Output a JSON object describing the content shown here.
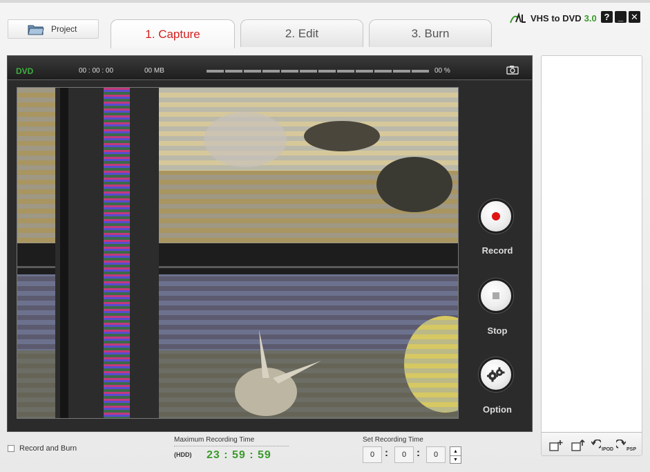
{
  "project_button": {
    "label": "Project",
    "icon": "folder-icon"
  },
  "tabs": [
    {
      "label": "1. Capture",
      "active": true
    },
    {
      "label": "2. Edit",
      "active": false
    },
    {
      "label": "3. Burn",
      "active": false
    }
  ],
  "brand": {
    "name": "VHS to DVD",
    "version": "3.0"
  },
  "window_buttons": {
    "help": "?",
    "minimize": "_",
    "close": "✕"
  },
  "status_bar": {
    "format": "DVD",
    "elapsed": "00 : 00 : 00",
    "size": "00 MB",
    "progress_percent": "00 %",
    "progress_value": 0
  },
  "controls": {
    "record": "Record",
    "stop": "Stop",
    "option": "Option"
  },
  "bottom": {
    "record_and_burn_label": "Record and Burn",
    "record_and_burn_checked": false,
    "max_recording_label": "Maximum Recording Time",
    "storage_label": "(HDD)",
    "max_recording_value": "23 : 59 : 59",
    "set_recording_label": "Set Recording Time",
    "set_hours": "0",
    "set_minutes": "0",
    "set_seconds": "0"
  },
  "side_tools": {
    "ipod_label": "IPOD",
    "psp_label": "PSP"
  },
  "colors": {
    "accent_green": "#3a9a2a",
    "active_tab_red": "#d42020",
    "record_red": "#e01414",
    "panel_dark": "#2b2b2b"
  }
}
